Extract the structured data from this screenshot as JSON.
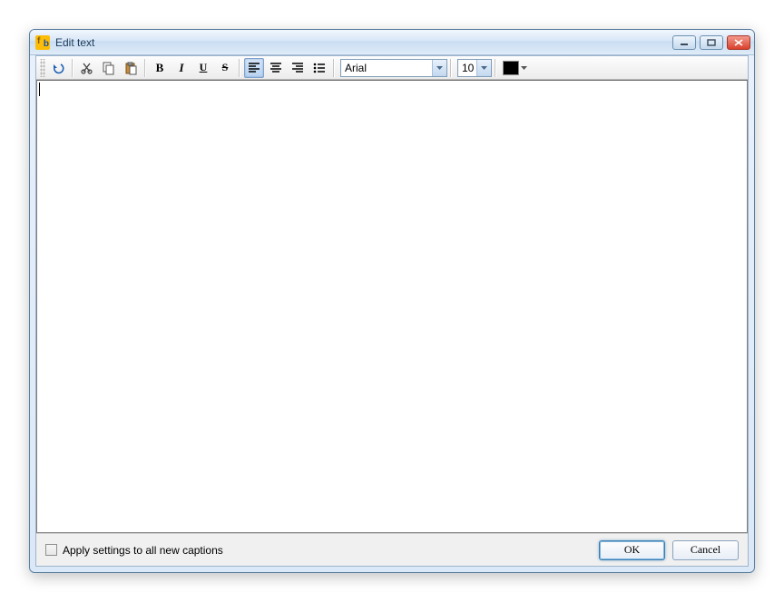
{
  "window": {
    "title": "Edit text"
  },
  "toolbar": {
    "font": "Arial",
    "size": "10",
    "color_hex": "#000000"
  },
  "editor": {
    "content": ""
  },
  "bottom": {
    "checkbox_label": "Apply settings to all new captions",
    "ok_label": "OK",
    "cancel_label": "Cancel"
  }
}
